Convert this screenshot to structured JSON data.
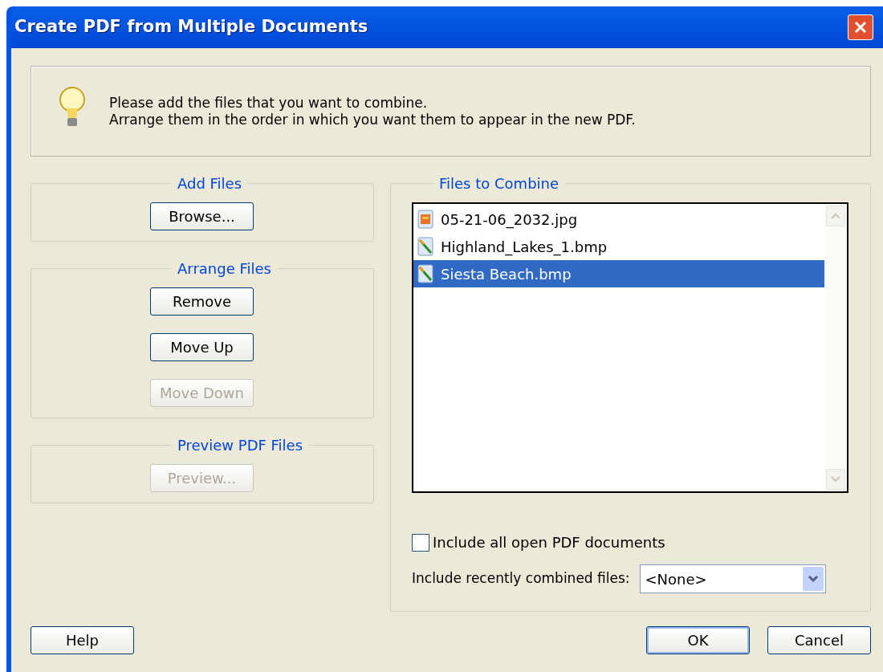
{
  "window": {
    "title": "Create PDF from Multiple Documents"
  },
  "info": {
    "lines": [
      "Please add the files that you want to combine.",
      "Arrange them in the order in which you want them to appear in the new PDF."
    ]
  },
  "groups": [
    {
      "title": "Add Files",
      "buttons": [
        {
          "label": "Browse...",
          "disabled": false
        }
      ]
    },
    {
      "title": "Arrange Files",
      "buttons": [
        {
          "label": "Remove",
          "disabled": false
        },
        {
          "label": "Move Up",
          "disabled": false
        },
        {
          "label": "Move Down",
          "disabled": true
        }
      ]
    },
    {
      "title": "Preview PDF Files",
      "buttons": [
        {
          "label": "Preview...",
          "disabled": true
        }
      ]
    }
  ],
  "files_to_combine": {
    "title": "Files to Combine",
    "items": [
      {
        "name": "05-21-06_2032.jpg",
        "kind": "jpg",
        "selected": false
      },
      {
        "name": "Highland_Lakes_1.bmp",
        "kind": "bmp",
        "selected": false
      },
      {
        "name": "Siesta Beach.bmp",
        "kind": "bmp",
        "selected": true
      }
    ],
    "include_open": {
      "label": "Include all open PDF documents",
      "checked": false
    },
    "recent": {
      "label": "Include recently combined files:",
      "value": "<None>"
    }
  },
  "footer_buttons": [
    {
      "label": "Help",
      "default": false
    },
    {
      "label": "OK",
      "default": true
    },
    {
      "label": "Cancel",
      "default": false
    }
  ]
}
